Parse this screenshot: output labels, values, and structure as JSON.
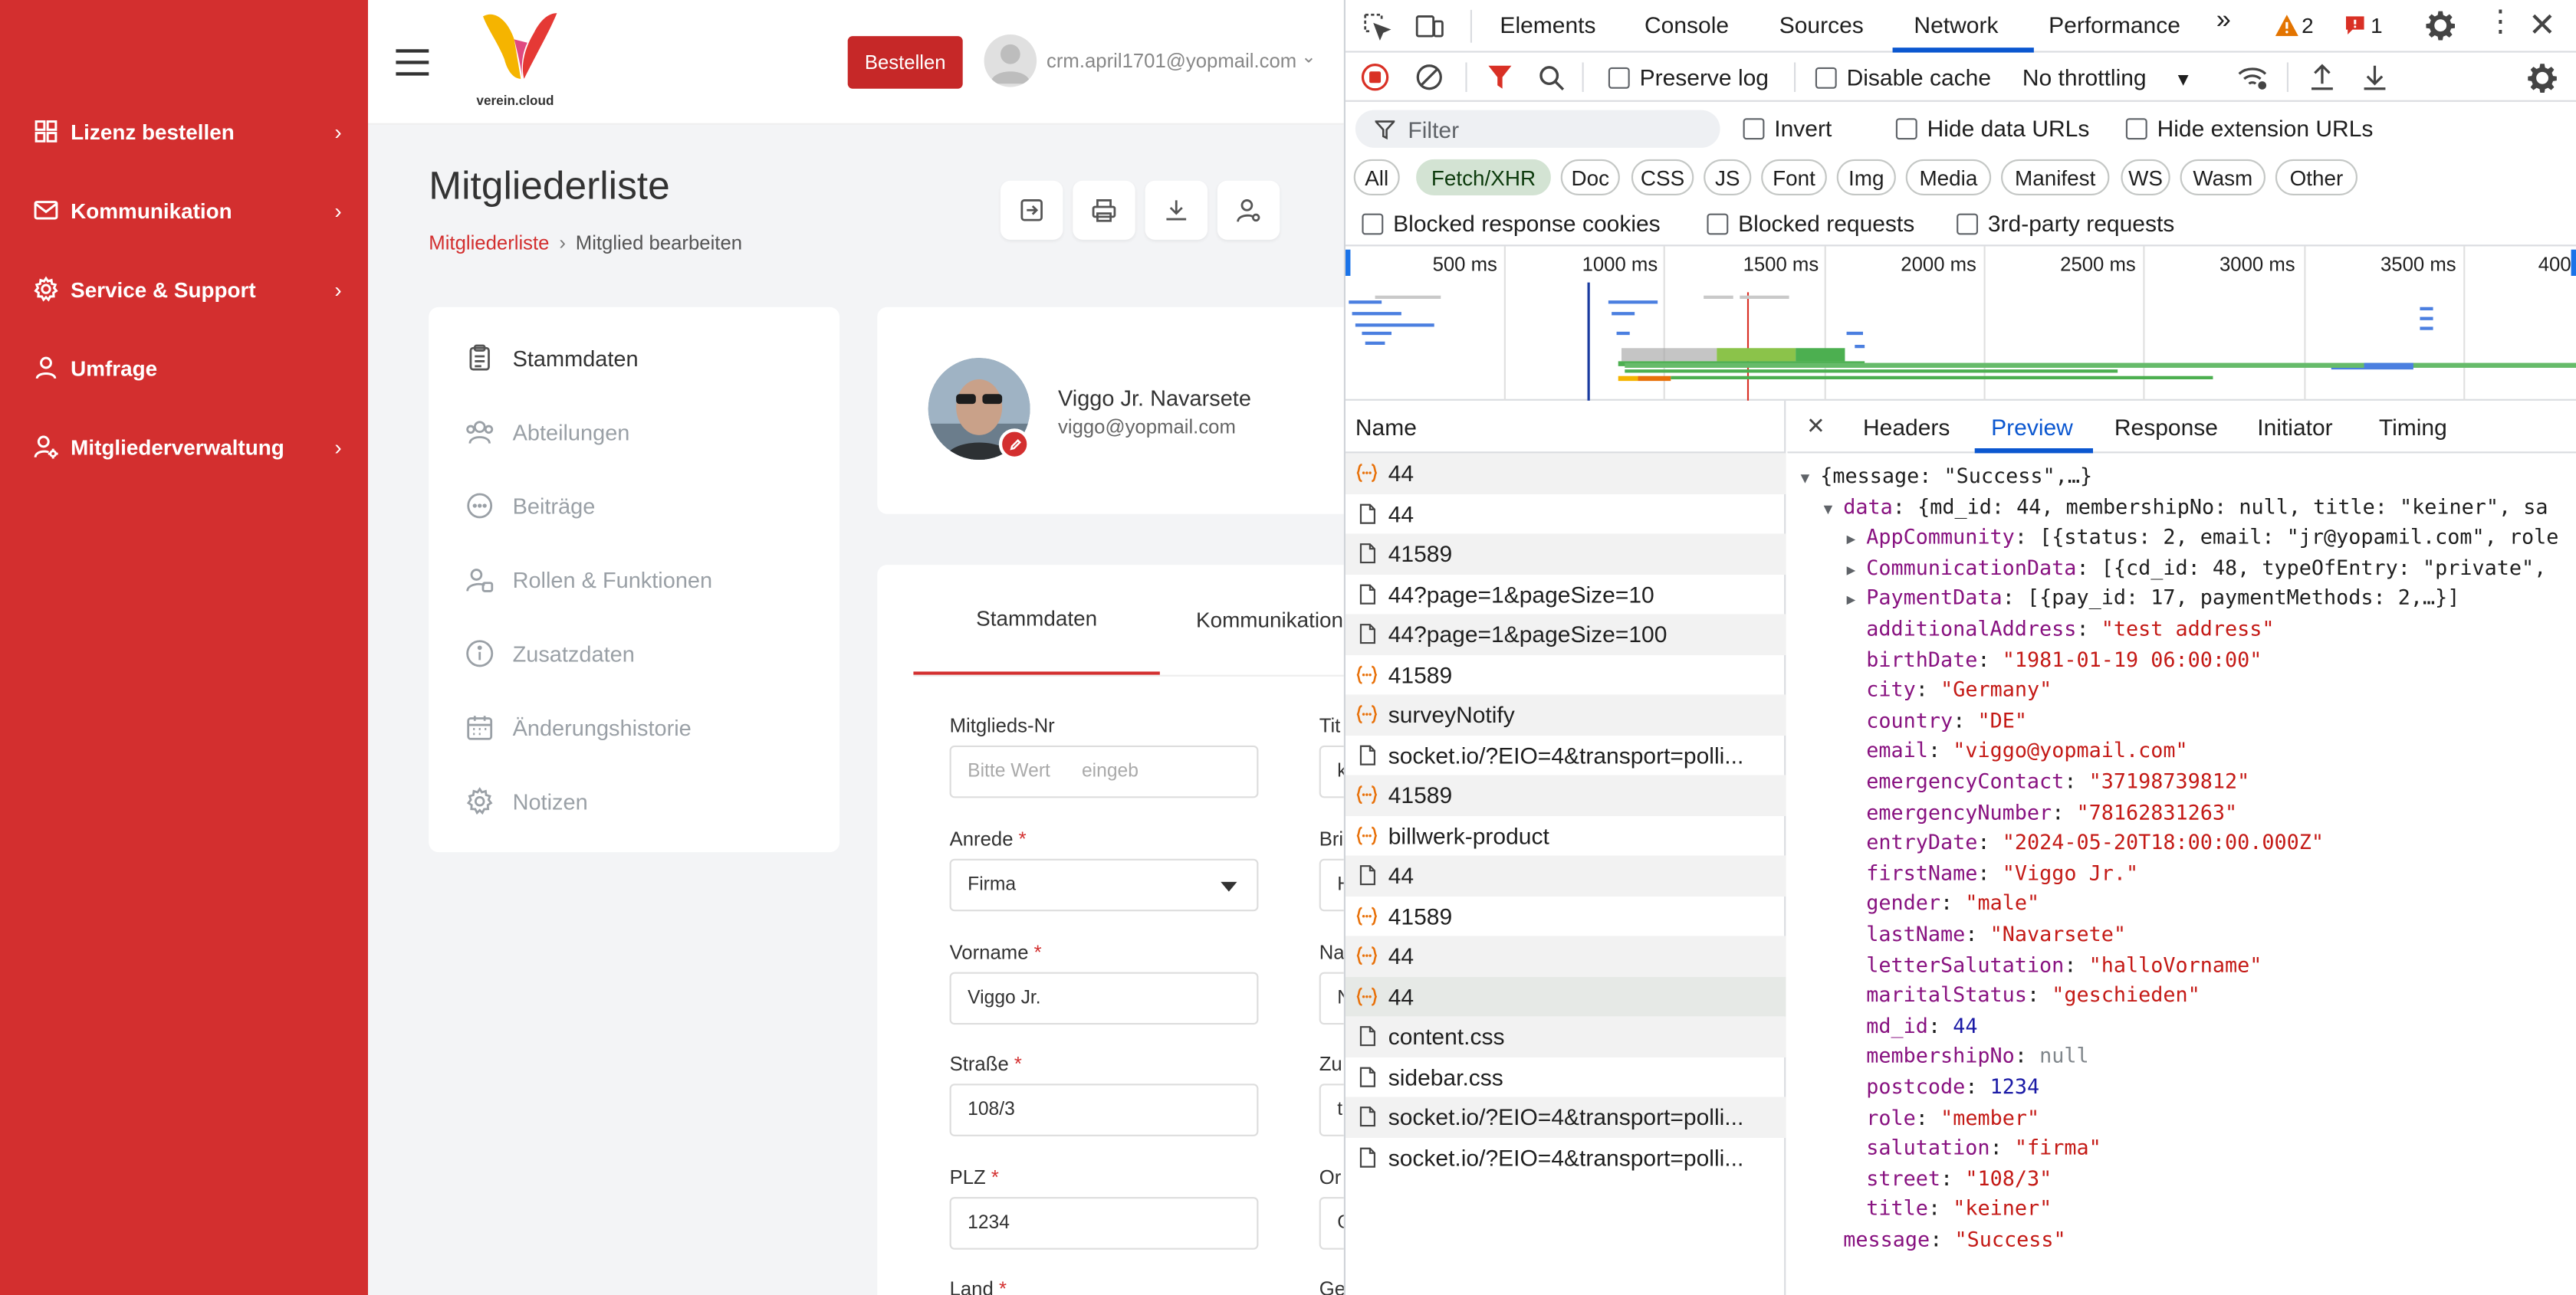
{
  "sidebar": {
    "items": [
      {
        "label": "Lizenz bestellen",
        "icon": "grid-icon",
        "has_chevron": true
      },
      {
        "label": "Kommunikation",
        "icon": "mail-icon",
        "has_chevron": true
      },
      {
        "label": "Service & Support",
        "icon": "gear-icon",
        "has_chevron": true
      },
      {
        "label": "Umfrage",
        "icon": "user-icon",
        "has_chevron": false
      },
      {
        "label": "Mitgliederverwaltung",
        "icon": "user-gear-icon",
        "has_chevron": true
      }
    ],
    "chevron": "›",
    "color": "#d32f2f"
  },
  "topbar": {
    "logo_text": "verein.cloud",
    "order_button": "Bestellen",
    "user_email": "crm.april1701@yopmail.com",
    "user_chevron": "⌄"
  },
  "page": {
    "title": "Mitgliederliste",
    "breadcrumb_root": "Mitgliederliste",
    "breadcrumb_sep": "›",
    "breadcrumb_current": "Mitglied bearbeiten"
  },
  "left_menu": [
    {
      "label": "Stammdaten",
      "icon": "clipboard-icon",
      "active": true
    },
    {
      "label": "Abteilungen",
      "icon": "users-icon",
      "active": false
    },
    {
      "label": "Beiträge",
      "icon": "chat-icon",
      "active": false
    },
    {
      "label": "Rollen & Funktionen",
      "icon": "user-roles-icon",
      "active": false
    },
    {
      "label": "Zusatzdaten",
      "icon": "info-icon",
      "active": false
    },
    {
      "label": "Änderungshistorie",
      "icon": "calendar-icon",
      "active": false
    },
    {
      "label": "Notizen",
      "icon": "settings-icon",
      "active": false
    }
  ],
  "profile": {
    "name": "Viggo Jr. Navarsete",
    "email": "viggo@yopmail.com"
  },
  "form_tabs": [
    {
      "label": "Stammdaten",
      "active": true
    },
    {
      "label": "Kommunikation",
      "active": false
    }
  ],
  "form": {
    "mitglieds_nr_label": "Mitglieds-Nr",
    "mitglieds_nr_placeholder": "Bitte Wert      eingeb",
    "anrede_label": "Anrede",
    "anrede_value": "Firma",
    "vorname_label": "Vorname",
    "vorname_value": "Viggo Jr.",
    "strasse_label": "Straße",
    "strasse_value": "108/3",
    "plz_label": "PLZ",
    "plz_value": "1234",
    "land_label": "Land",
    "required_mark": "*",
    "right_col_labels": [
      "Tit",
      "Bri",
      "Na",
      "Zu",
      "Or",
      "Ge"
    ],
    "right_col_values": [
      "k",
      "H",
      "N",
      "t",
      "G"
    ]
  },
  "devtools": {
    "tabs": [
      "Elements",
      "Console",
      "Sources",
      "Network",
      "Performance"
    ],
    "active_tab": "Network",
    "more_tabs": "»",
    "warn_count": "2",
    "err_count": "1",
    "toolbar": {
      "preserve_log": "Preserve log",
      "disable_cache": "Disable cache",
      "throttling": "No throttling"
    },
    "filter": {
      "placeholder": "Filter",
      "invert": "Invert",
      "hide_data": "Hide data URLs",
      "hide_ext": "Hide extension URLs"
    },
    "type_filters": [
      "All",
      "Fetch/XHR",
      "Doc",
      "CSS",
      "JS",
      "Font",
      "Img",
      "Media",
      "Manifest",
      "WS",
      "Wasm",
      "Other"
    ],
    "active_type": "Fetch/XHR",
    "blocked": {
      "cookies": "Blocked response cookies",
      "requests": "Blocked requests",
      "third_party": "3rd-party requests"
    },
    "timeline_ticks": [
      "500 ms",
      "1000 ms",
      "1500 ms",
      "2000 ms",
      "2500 ms",
      "3000 ms",
      "3500 ms",
      "400"
    ],
    "name_header": "Name",
    "requests": [
      {
        "name": "44",
        "type": "xhr"
      },
      {
        "name": "44",
        "type": "doc"
      },
      {
        "name": "41589",
        "type": "doc"
      },
      {
        "name": "44?page=1&pageSize=10",
        "type": "doc"
      },
      {
        "name": "44?page=1&pageSize=100",
        "type": "doc"
      },
      {
        "name": "41589",
        "type": "xhr"
      },
      {
        "name": "surveyNotify",
        "type": "xhr"
      },
      {
        "name": "socket.io/?EIO=4&transport=polli...",
        "type": "doc"
      },
      {
        "name": "41589",
        "type": "xhr"
      },
      {
        "name": "billwerk-product",
        "type": "xhr"
      },
      {
        "name": "44",
        "type": "doc"
      },
      {
        "name": "41589",
        "type": "xhr"
      },
      {
        "name": "44",
        "type": "xhr"
      },
      {
        "name": "44",
        "type": "xhr"
      },
      {
        "name": "content.css",
        "type": "doc"
      },
      {
        "name": "sidebar.css",
        "type": "doc"
      },
      {
        "name": "socket.io/?EIO=4&transport=polli...",
        "type": "doc"
      },
      {
        "name": "socket.io/?EIO=4&transport=polli...",
        "type": "doc"
      }
    ],
    "selected_request_index": 13,
    "detail_tabs": [
      "Headers",
      "Preview",
      "Response",
      "Initiator",
      "Timing"
    ],
    "active_detail_tab": "Preview",
    "close": "×",
    "preview": {
      "root": "{message: \"Success\",…}",
      "data_key": "data",
      "data_summary": "{md_id: 44, membershipNo: null, title: \"keiner\", sa",
      "collapsed": [
        {
          "key": "AppCommunity",
          "value": "[{status: 2, email: \"jr@yopamil.com\", role"
        },
        {
          "key": "CommunicationData",
          "value": "[{cd_id: 48, typeOfEntry: \"private\","
        },
        {
          "key": "PaymentData",
          "value": "[{pay_id: 17, paymentMethods: 2,…}]"
        }
      ],
      "fields": [
        {
          "key": "additionalAddress",
          "value": "\"test address\"",
          "kind": "string"
        },
        {
          "key": "birthDate",
          "value": "\"1981-01-19 06:00:00\"",
          "kind": "string"
        },
        {
          "key": "city",
          "value": "\"Germany\"",
          "kind": "string"
        },
        {
          "key": "country",
          "value": "\"DE\"",
          "kind": "string"
        },
        {
          "key": "email",
          "value": "\"viggo@yopmail.com\"",
          "kind": "string"
        },
        {
          "key": "emergencyContact",
          "value": "\"37198739812\"",
          "kind": "string"
        },
        {
          "key": "emergencyNumber",
          "value": "\"78162831263\"",
          "kind": "string"
        },
        {
          "key": "entryDate",
          "value": "\"2024-05-20T18:00:00.000Z\"",
          "kind": "string"
        },
        {
          "key": "firstName",
          "value": "\"Viggo Jr.\"",
          "kind": "string"
        },
        {
          "key": "gender",
          "value": "\"male\"",
          "kind": "string"
        },
        {
          "key": "lastName",
          "value": "\"Navarsete\"",
          "kind": "string"
        },
        {
          "key": "letterSalutation",
          "value": "\"halloVorname\"",
          "kind": "string"
        },
        {
          "key": "maritalStatus",
          "value": "\"geschieden\"",
          "kind": "string"
        },
        {
          "key": "md_id",
          "value": "44",
          "kind": "number"
        },
        {
          "key": "membershipNo",
          "value": "null",
          "kind": "null"
        },
        {
          "key": "postcode",
          "value": "1234",
          "kind": "number"
        },
        {
          "key": "role",
          "value": "\"member\"",
          "kind": "string"
        },
        {
          "key": "salutation",
          "value": "\"firma\"",
          "kind": "string"
        },
        {
          "key": "street",
          "value": "\"108/3\"",
          "kind": "string"
        },
        {
          "key": "title",
          "value": "\"keiner\"",
          "kind": "string"
        }
      ],
      "message_key": "message",
      "message_value": "\"Success\""
    }
  }
}
